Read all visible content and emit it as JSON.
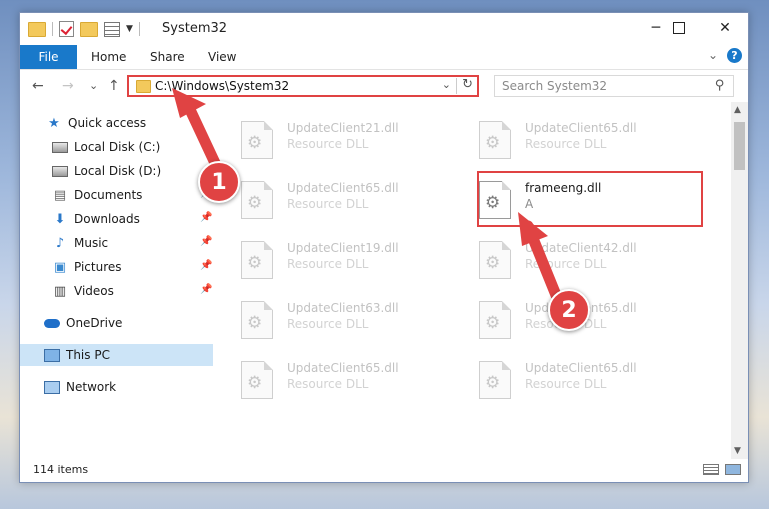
{
  "window": {
    "title": "System32"
  },
  "ribbon": {
    "tabs": [
      "File",
      "Home",
      "Share",
      "View"
    ],
    "help": "?"
  },
  "nav": {
    "back": "←",
    "forward": "→",
    "recent": "⌄",
    "up": "↑",
    "address": "C:\\Windows\\System32",
    "refresh": "↻",
    "search_placeholder": "Search System32"
  },
  "sidebar": {
    "items": [
      {
        "label": "Quick access"
      },
      {
        "label": "Local Disk (C:)"
      },
      {
        "label": "Local Disk (D:)"
      },
      {
        "label": "Documents"
      },
      {
        "label": "Downloads"
      },
      {
        "label": "Music"
      },
      {
        "label": "Pictures"
      },
      {
        "label": "Videos"
      },
      {
        "label": "OneDrive"
      },
      {
        "label": "This PC"
      },
      {
        "label": "Network"
      }
    ]
  },
  "files": [
    {
      "name": "UpdateClient21.dll",
      "type": "Resource DLL"
    },
    {
      "name": "UpdateClient65.dll",
      "type": "Resource DLL"
    },
    {
      "name": "UpdateClient65.dll",
      "type": "Resource DLL"
    },
    {
      "name": "frameeng.dll",
      "type": "A"
    },
    {
      "name": "UpdateClient19.dll",
      "type": "Resource DLL"
    },
    {
      "name": "UpdateClient42.dll",
      "type": "Resource DLL"
    },
    {
      "name": "UpdateClient63.dll",
      "type": "Resource DLL"
    },
    {
      "name": "UpdateClient65.dll",
      "type": "Resource DLL"
    },
    {
      "name": "UpdateClient65.dll",
      "type": "Resource DLL"
    },
    {
      "name": "UpdateClient65.dll",
      "type": "Resource DLL"
    }
  ],
  "status": {
    "item_count": "114 items"
  },
  "annotations": {
    "step1": "1",
    "step2": "2",
    "color": "#e04343"
  }
}
